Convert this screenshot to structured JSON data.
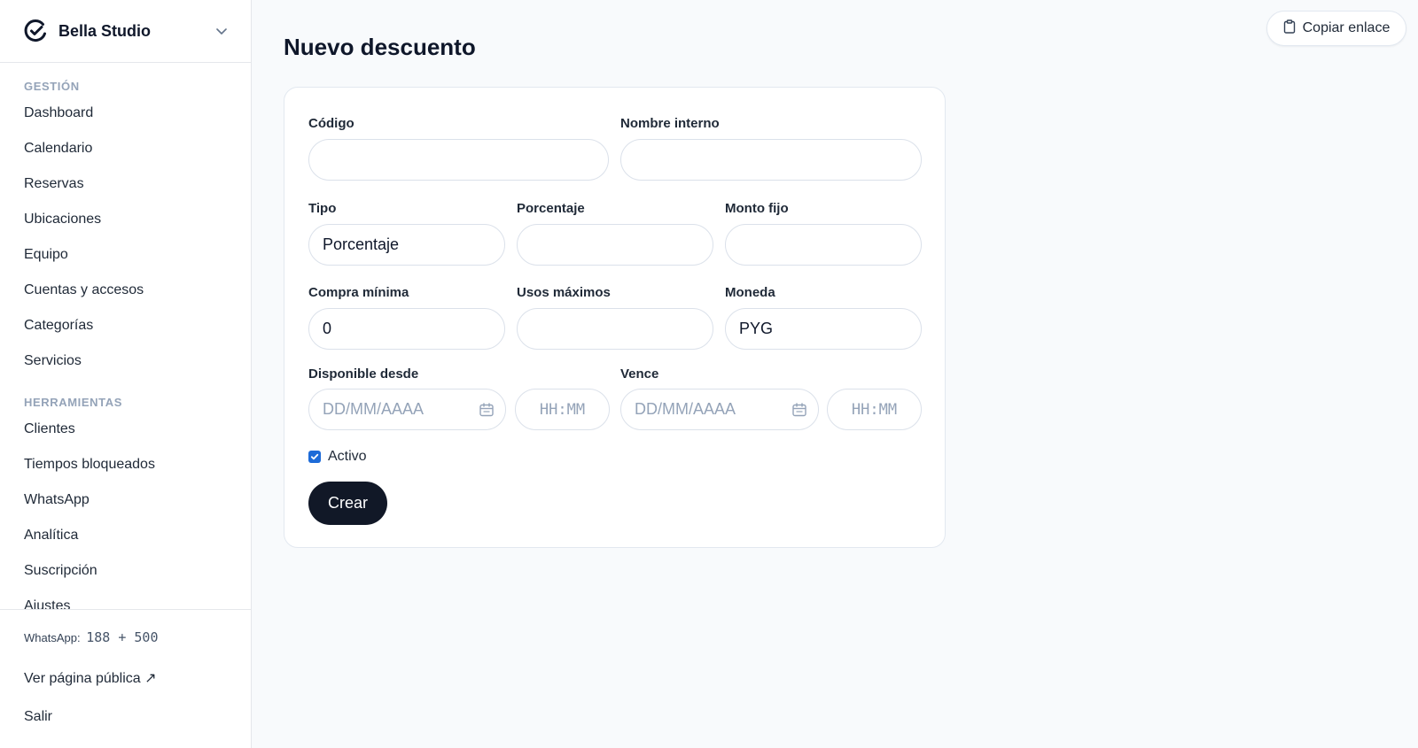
{
  "brand": {
    "name": "Bella Studio",
    "logo_icon": "check-circle-icon"
  },
  "nav": {
    "sections": [
      {
        "title": "GESTIÓN",
        "items": [
          "Dashboard",
          "Calendario",
          "Reservas",
          "Ubicaciones",
          "Equipo",
          "Cuentas y accesos",
          "Categorías",
          "Servicios"
        ]
      },
      {
        "title": "HERRAMIENTAS",
        "items": [
          "Clientes",
          "Tiempos bloqueados",
          "WhatsApp",
          "Analítica",
          "Suscripción",
          "Ajustes"
        ]
      }
    ]
  },
  "footer": {
    "whatsapp_label": "WhatsApp:",
    "whatsapp_value": "188 + 500",
    "public_page": "Ver página pública ↗",
    "logout": "Salir"
  },
  "header": {
    "copy_link": "Copiar enlace",
    "copy_icon": "clipboard-icon"
  },
  "page": {
    "title": "Nuevo descuento"
  },
  "form": {
    "code_label": "Código",
    "code_value": "",
    "internal_name_label": "Nombre interno",
    "internal_name_value": "",
    "type_label": "Tipo",
    "type_value": "Porcentaje",
    "percentage_label": "Porcentaje",
    "percentage_value": "",
    "fixed_amount_label": "Monto fijo",
    "fixed_amount_value": "",
    "min_purchase_label": "Compra mínima",
    "min_purchase_value": "0",
    "max_uses_label": "Usos máximos",
    "max_uses_value": "",
    "currency_label": "Moneda",
    "currency_value": "PYG",
    "available_from_label": "Disponible desde",
    "expires_label": "Vence",
    "date_placeholder": "DD/MM/AAAA",
    "time_placeholder": "HH:MM",
    "active_label": "Activo",
    "active_checked": true,
    "submit_label": "Crear"
  },
  "colors": {
    "accent": "#1d6bd8",
    "primary_button": "#111827",
    "background": "#f8fafc"
  }
}
